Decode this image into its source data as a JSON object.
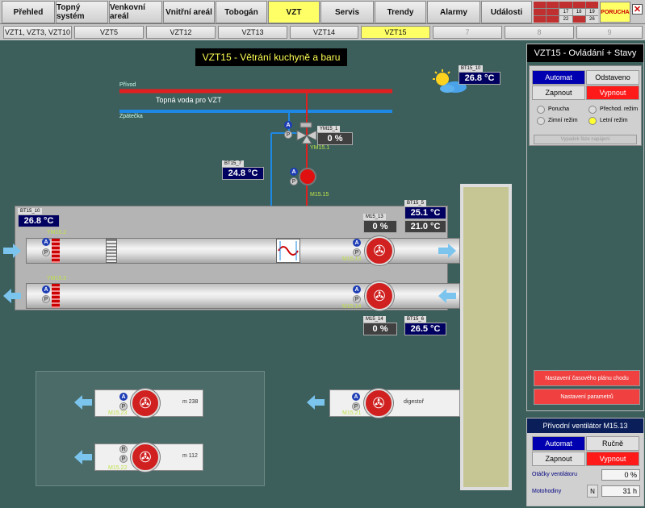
{
  "nav": {
    "tabs": [
      "Přehled",
      "Topný systém",
      "Venkovní areál",
      "Vnitřní areál",
      "Tobogán",
      "VZT",
      "Servis",
      "Trendy",
      "Alarmy",
      "Události"
    ],
    "active": "VZT",
    "alarm_grid": [
      "",
      "",
      "",
      "",
      "",
      "",
      "",
      "17",
      "18",
      "19",
      "",
      "",
      "22",
      "",
      "26"
    ],
    "porucha": "PORUCHA"
  },
  "subnav": {
    "tabs": [
      "VZT1, VZT3, VZT10",
      "VZT5",
      "VZT12",
      "VZT13",
      "VZT14",
      "VZT15",
      "7",
      "8",
      "9"
    ],
    "active": "VZT15"
  },
  "title": "VZT15 - Větrání kuchyně a baru",
  "lines": {
    "privod": "Přívod",
    "zpatecka": "Zpátečka",
    "topna_voda": "Topná voda pro VZT"
  },
  "sensors": {
    "bt15_10_top": {
      "label": "BT15_10",
      "value": "26.8 °C"
    },
    "bt15_7": {
      "label": "BT15_7",
      "value": "24.8 °C"
    },
    "bt15_10_left": {
      "label": "BT15_10",
      "value": "26.8 °C"
    },
    "bt15_5": {
      "label": "BT15_5",
      "value": "25.1 °C",
      "value2": "21.0 °C"
    },
    "bt15_6": {
      "label": "BT15_6",
      "value": "26.5 °C"
    },
    "ym15_1": {
      "label": "YM15_1",
      "value": "0 %"
    },
    "m15_13": {
      "label": "M15_13",
      "value": "0 %"
    },
    "m15_14": {
      "label": "M15_14",
      "value": "0 %"
    }
  },
  "devices": {
    "ym15_1": "YM15.1",
    "m15_15": "M15.15",
    "ym15_2": "YM15.2",
    "ym15_3": "YM15.3",
    "m15_13": "M15.13",
    "m15_14": "M15.14",
    "m15_23": "M15.23",
    "m15_22": "M15.22",
    "m15_21": "M15.21",
    "m238": "m 238",
    "m112": "m 112",
    "digestor": "digestoř"
  },
  "panel1": {
    "title": "VZT15 - Ovládání + Stavy",
    "automat": "Automat",
    "odstaveno": "Odstaveno",
    "zapnout": "Zapnout",
    "vypnout": "Vypnout",
    "radios": [
      "Porucha",
      "Přechod. režim",
      "Zimní režim",
      "Letní režim"
    ],
    "disabled_btn": "Vypadek fáze napájení",
    "btn_plan": "Nastavení časového plánu chodu",
    "btn_param": "Nastavení parametrů"
  },
  "panel2": {
    "title": "Přívodní ventilátor M15.13",
    "automat": "Automat",
    "rucne": "Ručně",
    "zapnout": "Zapnout",
    "vypnout": "Vypnout",
    "otacky_label": "Otáčky ventilátoru",
    "otacky_value": "0 %",
    "moto_label": "Motohodiny",
    "moto_btn": "N",
    "moto_value": "31 h"
  },
  "colors": {
    "accent": "#ffff66",
    "supply": "#e02020",
    "return": "#1e88e5",
    "panel_bg": "#3c5f5c"
  }
}
